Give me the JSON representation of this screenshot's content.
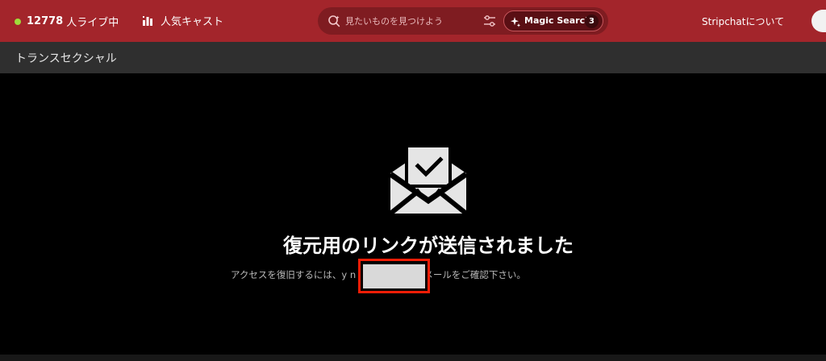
{
  "header": {
    "live_count": "12778",
    "live_label": "人ライブ中",
    "popular_label": "人気キャスト",
    "search": {
      "placeholder": "見たいものを見つけよう",
      "magic_label": "Magic Search",
      "magic_count": "3"
    },
    "about_label": "Stripchatについて"
  },
  "category": {
    "title": "トランスセクシャル"
  },
  "main": {
    "title": "復元用のリンクが送信されました",
    "message": "アクセスを復旧するには、y                      n 宛に送信されたメールをご確認下さい。"
  },
  "colors": {
    "header_bg": "#a3252b",
    "search_bg": "#7f1c21",
    "live_dot": "#9fdc3b",
    "category_bg": "#2f2f2f",
    "main_bg": "#000000",
    "highlight_border": "#f41d06",
    "redaction_fill": "#d9d9d9"
  },
  "icons": {
    "live": "green-status-dot",
    "popular": "popular-bars-icon",
    "search": "sparkle-search-icon",
    "filter": "slider-filter-icon",
    "magic": "sparkle-icon",
    "confirmation": "open-envelope-check-icon"
  }
}
